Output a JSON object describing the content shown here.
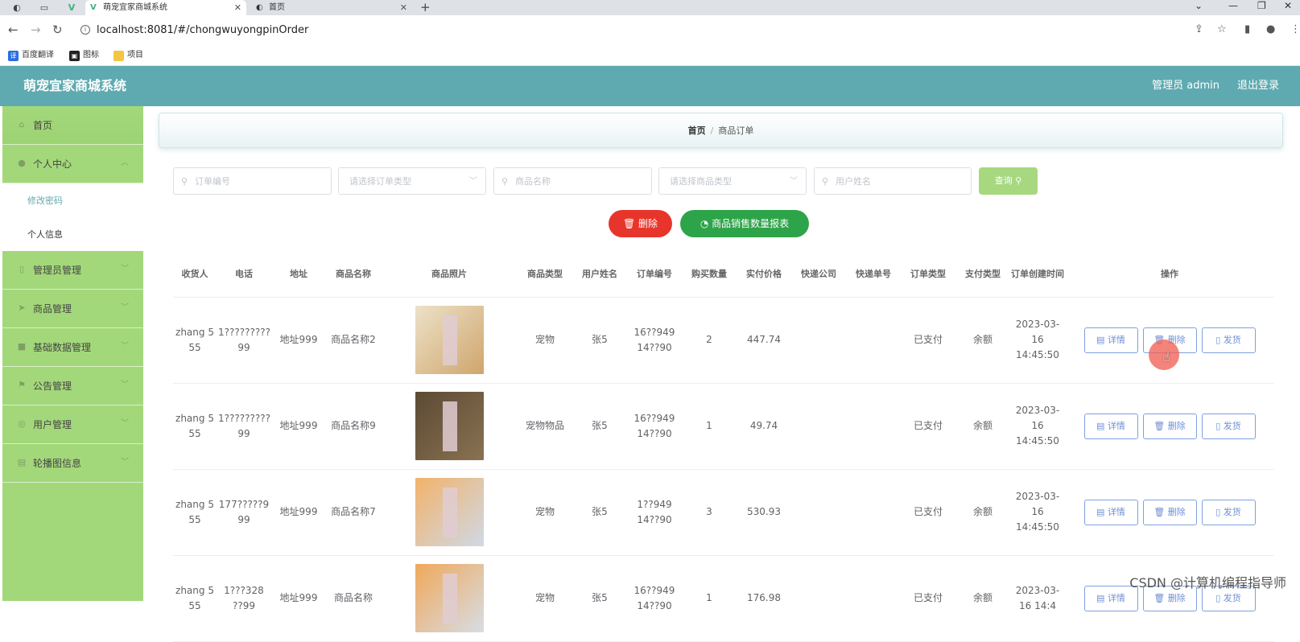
{
  "browser": {
    "tabs": [
      {
        "title": "萌宠宜家商城系统",
        "active": true
      },
      {
        "title": "首页",
        "active": false
      }
    ],
    "url": "localhost:8081/#/chongwuyongpinOrder",
    "bookmarks": [
      "百度翻译",
      "图标",
      "项目"
    ]
  },
  "header": {
    "title": "萌宠宜家商城系统",
    "admin_label": "管理员 admin",
    "logout_label": "退出登录"
  },
  "sidebar": {
    "items": [
      {
        "label": "首页",
        "icon": "home-icon"
      },
      {
        "label": "个人中心",
        "icon": "user-icon"
      },
      {
        "label": "管理员管理",
        "icon": "phone-icon"
      },
      {
        "label": "商品管理",
        "icon": "send-icon"
      },
      {
        "label": "基础数据管理",
        "icon": "briefcase-icon"
      },
      {
        "label": "公告管理",
        "icon": "flag-icon"
      },
      {
        "label": "用户管理",
        "icon": "target-icon"
      },
      {
        "label": "轮播图信息",
        "icon": "document-icon"
      }
    ],
    "sub_items": [
      "修改密码",
      "个人信息"
    ]
  },
  "breadcrumb": {
    "home": "首页",
    "current": "商品订单"
  },
  "search": {
    "order_no_placeholder": "订单编号",
    "order_type_placeholder": "请选择订单类型",
    "product_name_placeholder": "商品名称",
    "product_type_placeholder": "请选择商品类型",
    "user_name_placeholder": "用户姓名",
    "search_label": "查询"
  },
  "actions": {
    "delete_label": "删除",
    "report_label": "商品销售数量报表"
  },
  "table": {
    "columns": [
      "收货人",
      "电话",
      "地址",
      "商品名称",
      "商品照片",
      "商品类型",
      "用户姓名",
      "订单编号",
      "购买数量",
      "实付价格",
      "快递公司",
      "快递单号",
      "订单类型",
      "支付类型",
      "订单创建时间",
      "操作"
    ],
    "rows": [
      {
        "receiver": "zhang 5 55",
        "phone": "1?????????99",
        "address": "地址999",
        "product": "商品名称2",
        "type": "宠物",
        "user": "张5",
        "order_no": "16??949 14??90",
        "qty": "2",
        "price": "447.74",
        "courier": "",
        "tracking": "",
        "order_type": "已支付",
        "pay_type": "余额",
        "created": "2023-03-16 14:45:50",
        "colors": [
          "#ede2c8",
          "#cfa56d"
        ]
      },
      {
        "receiver": "zhang 5 55",
        "phone": "1?????????99",
        "address": "地址999",
        "product": "商品名称9",
        "type": "宠物物品",
        "user": "张5",
        "order_no": "16??949 14??90",
        "qty": "1",
        "price": "49.74",
        "courier": "",
        "tracking": "",
        "order_type": "已支付",
        "pay_type": "余额",
        "created": "2023-03-16 14:45:50",
        "colors": [
          "#5c4a34",
          "#8a7252"
        ]
      },
      {
        "receiver": "zhang 5 55",
        "phone": "177?????9 99",
        "address": "地址999",
        "product": "商品名称7",
        "type": "宠物",
        "user": "张5",
        "order_no": "1??949 14??90",
        "qty": "3",
        "price": "530.93",
        "courier": "",
        "tracking": "",
        "order_type": "已支付",
        "pay_type": "余额",
        "created": "2023-03-16 14:45:50",
        "colors": [
          "#f3b26a",
          "#cfd9e6"
        ]
      },
      {
        "receiver": "zhang 5 55",
        "phone": "1???328 ??99",
        "address": "地址999",
        "product": "商品名称",
        "type": "宠物",
        "user": "张5",
        "order_no": "16??949 14??90",
        "qty": "1",
        "price": "176.98",
        "courier": "",
        "tracking": "",
        "order_type": "已支付",
        "pay_type": "余额",
        "created": "2023-03-16 14:4",
        "colors": [
          "#f0a85a",
          "#d7dde6"
        ]
      }
    ],
    "op_labels": {
      "detail": "详情",
      "delete": "删除",
      "ship": "发货"
    }
  },
  "watermark": "CSDN @计算机编程指导师"
}
